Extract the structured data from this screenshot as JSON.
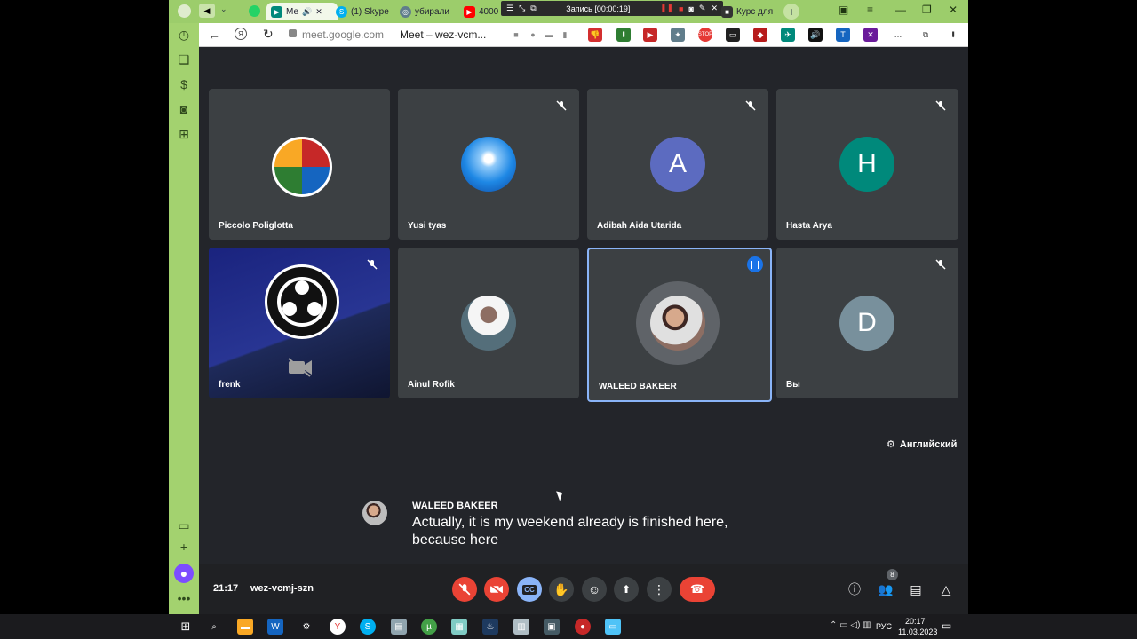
{
  "browser": {
    "tabs": [
      {
        "label": "Ме",
        "icon": "meet-icon"
      },
      {
        "label": "(1) Skype",
        "icon": "skype-icon"
      },
      {
        "label": "убирали",
        "icon": "app-icon"
      },
      {
        "label": "4000",
        "icon": "youtube-icon"
      },
      {
        "label": "Курс для",
        "icon": "page-icon"
      }
    ],
    "recording": "Запись [00:00:19]",
    "url": "meet.google.com",
    "page_title": "Meet – wez-vcm..."
  },
  "participants": [
    {
      "name": "Piccolo Poliglotta",
      "muted": false,
      "avatar": "flags-avatar"
    },
    {
      "name": "Yusi tyas",
      "muted": true,
      "avatar": "winter-avatar"
    },
    {
      "name": "Adibah Aida Utarida",
      "muted": true,
      "initial": "A",
      "color": "#5c6bc0"
    },
    {
      "name": "Hasta Arya",
      "muted": true,
      "initial": "H",
      "color": "#00897b"
    },
    {
      "name": "frenk",
      "muted": true,
      "avatar": "obs-avatar"
    },
    {
      "name": "Ainul Rofik",
      "muted": false,
      "avatar": "photo-avatar"
    },
    {
      "name": "WALEED BAKEER",
      "muted": false,
      "speaking": true,
      "avatar": "photo-avatar"
    },
    {
      "name": "Вы",
      "muted": true,
      "initial": "D",
      "color": "#78909c"
    }
  ],
  "captions": {
    "language": "Английский",
    "speaker": "WALEED BAKEER",
    "text": "Actually, it is my weekend already is finished here, because here"
  },
  "bottom": {
    "time": "21:17",
    "meeting_code": "wez-vcmj-szn",
    "people_count": "8"
  },
  "taskbar": {
    "lang": "РУС",
    "clock_time": "20:17",
    "clock_date": "11.03.2023"
  },
  "colors": {
    "meet_bg": "#202124",
    "tile_bg": "#3c4043",
    "end_call": "#ea4335",
    "accent": "#8ab4f8",
    "browser_green": "#a3d26f"
  }
}
